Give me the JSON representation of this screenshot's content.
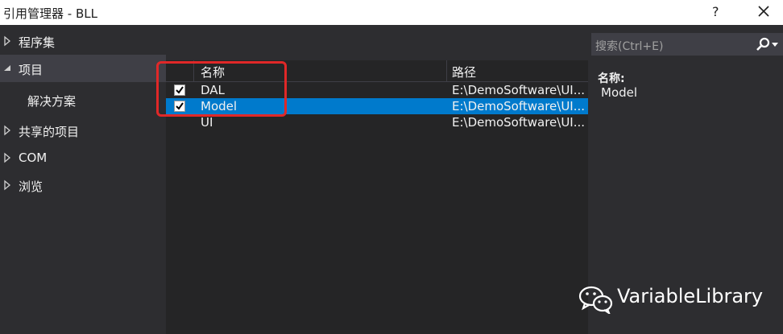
{
  "window": {
    "title": "引用管理器 - BLL",
    "help_label": "?"
  },
  "sidebar": {
    "items": [
      {
        "label": "程序集"
      },
      {
        "label": "项目"
      },
      {
        "label": "解决方案"
      },
      {
        "label": "共享的项目"
      },
      {
        "label": "COM"
      },
      {
        "label": "浏览"
      }
    ]
  },
  "list": {
    "columns": {
      "name": "名称",
      "path": "路径"
    },
    "rows": [
      {
        "name": "DAL",
        "path": "E:\\DemoSoftware\\UI..."
      },
      {
        "name": "Model",
        "path": "E:\\DemoSoftware\\UI..."
      },
      {
        "name": "UI",
        "path": "E:\\DemoSoftware\\UI..."
      }
    ]
  },
  "search": {
    "placeholder": "搜索(Ctrl+E)"
  },
  "detail": {
    "label": "名称:",
    "value": "Model"
  },
  "watermark": {
    "text": "VariableLibrary"
  },
  "colors": {
    "accent": "#007acc",
    "annotation": "#e02828",
    "background": "#2d2d30"
  }
}
